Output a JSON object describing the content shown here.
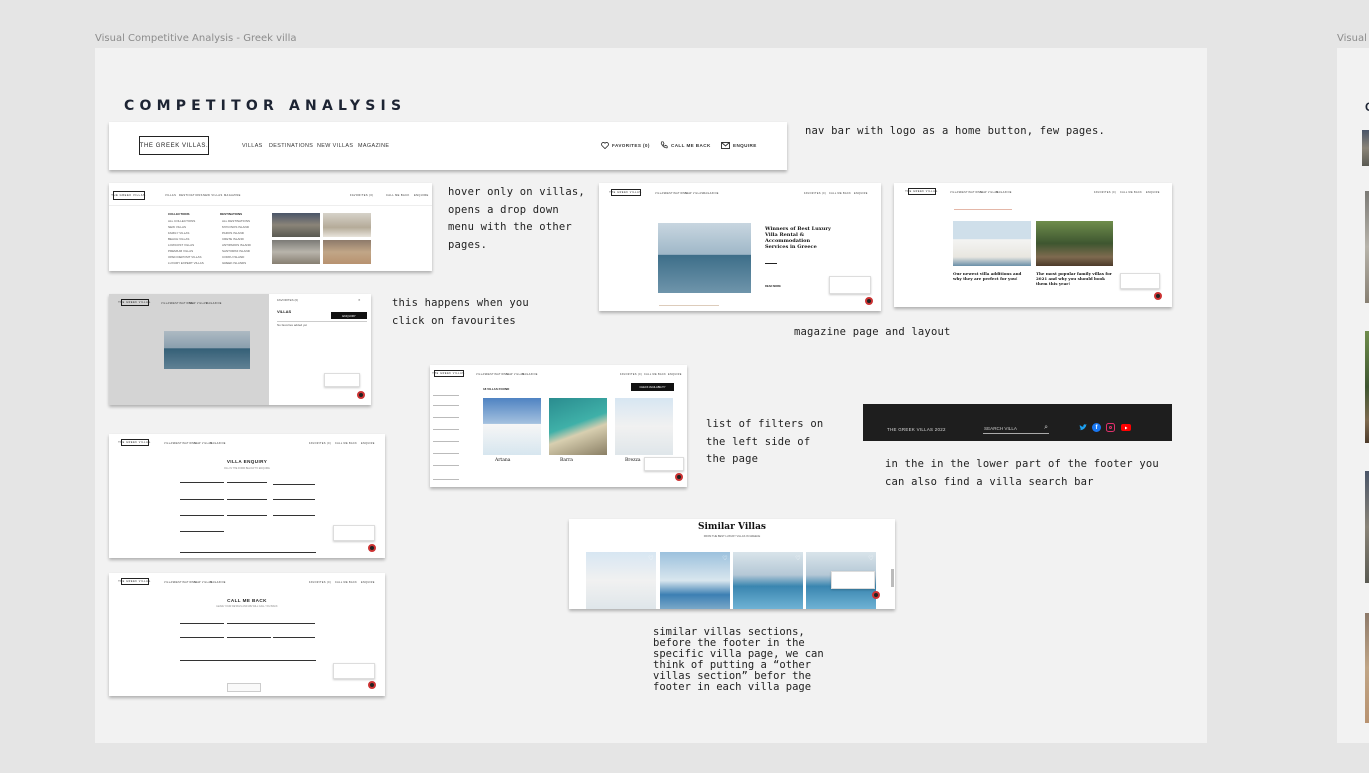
{
  "frames": {
    "left_label": "Visual Competitive Analysis - Greek villa",
    "right_label": "Visual"
  },
  "title": "COMPETITOR ANALYSIS",
  "navbar": {
    "logo": "THE GREEK VILLAS.",
    "links": [
      "VILLAS",
      "DESTINATIONS",
      "NEW VILLAS",
      "MAGAZINE"
    ],
    "actions": [
      "FAVORITES (0)",
      "CALL ME BACK",
      "ENQUIRE"
    ]
  },
  "dropdown": {
    "collections_title": "COLLECTIONS",
    "collections": [
      "ALL COLLECTIONS",
      "NEW VILLAS",
      "FAMILY VILLAS",
      "BEACH VILLAS",
      "LOWCOST VILLAS",
      "PREMIUM VILLAS",
      "OPEN DEPOSIT VILLAS",
      "LUXURY EXPERT VILLAS"
    ],
    "destinations_title": "DESTINATIONS",
    "destinations": [
      "ALL DESTINATIONS",
      "MYKONOS ISLAND",
      "PAROS ISLAND",
      "CRETE ISLAND",
      "ANTIPAROS ISLAND",
      "SANTORINI ISLAND",
      "CORFU ISLAND",
      "GREEK ISLANDS"
    ]
  },
  "favourites_panel": {
    "panel_title": "VILLAS",
    "panel_button": "ENQUIRY",
    "panel_text": "No favorites added yet"
  },
  "magazine": {
    "article1": "Winners of Best Luxury Villa Rental & Accommodation Services in Greece",
    "read_more": "READ MORE",
    "article2": "Our newest villa additions and why they are perfect for you!",
    "article3": "The most popular family villas for 2021 and why you should book them this year!"
  },
  "filters": {
    "villas_found": "18 VILLAS FOUND",
    "cta": "CHECK AVAILABILITY",
    "cards": [
      "Artana",
      "Barra",
      "Brezza"
    ]
  },
  "footer": {
    "brand": "THE GREEK VILLAS 2022",
    "search_placeholder": "SEARCH VILLA"
  },
  "enquiry_form": {
    "title": "VILLA ENQUIRY",
    "subtitle": "FILL IN THE FORM BELOW TO ENQUIRE"
  },
  "callback_form": {
    "title": "CALL ME BACK",
    "subtitle": "LEAVE YOUR DETAILS AND WE WILL CALL YOU BACK"
  },
  "similar": {
    "title": "Similar Villas",
    "subtitle": "FROM THE BEST LUXURY VILLAS IN GREECE"
  },
  "notes": {
    "nav": "nav bar with logo as a home button, few pages.",
    "hover": "hover only on villas,\nopens a drop down\nmenu with the other\npages.",
    "favourites": "this happens when you\nclick on favourites",
    "magazine": "magazine page and layout",
    "filters": "list of filters on\nthe left side of\nthe page",
    "footer": "in the in the lower part of the footer you\ncan also find a villa search bar",
    "similar": "similar villas sections,\nbefore the footer in the\nspecific villa page, we can\nthink of putting a “other\nvillas section” befor the\nfooter in each villa page"
  },
  "colors": {
    "canvas": "#e5e5e5",
    "frame": "#f2f2f2",
    "title": "#1d2433",
    "footer_bg": "#1e1e1e",
    "twitter": "#1da1f2",
    "facebook": "#1877f2",
    "instagram": "#e1306c",
    "youtube": "#ff0000"
  }
}
